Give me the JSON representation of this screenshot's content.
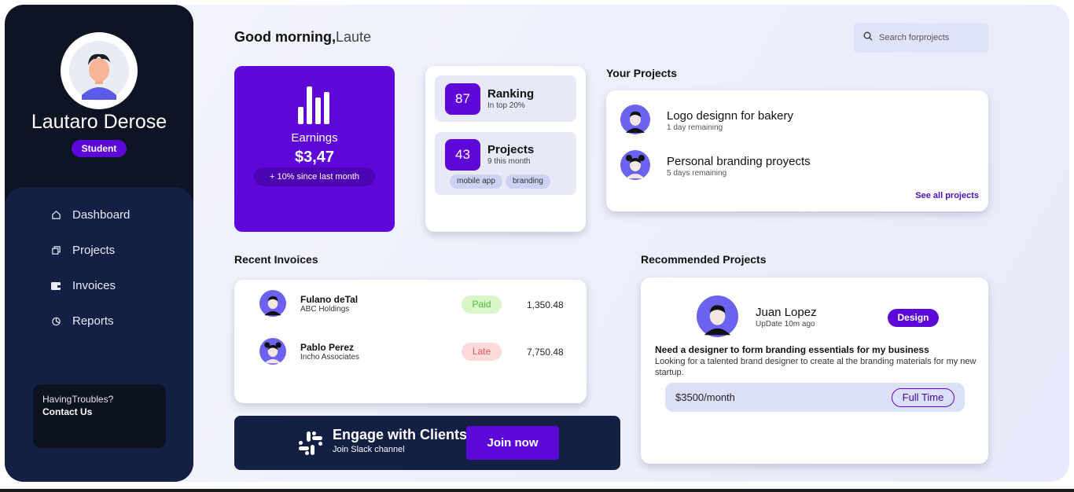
{
  "header": {
    "greeting": "Good morning,",
    "greeting_name": "Laute",
    "search_placeholder": "Search forprojects"
  },
  "sidebar": {
    "user_name": "Lautaro Derose",
    "role": "Student",
    "items": [
      {
        "label": "Dashboard",
        "icon": "home-icon"
      },
      {
        "label": "Projects",
        "icon": "copy-icon"
      },
      {
        "label": "Invoices",
        "icon": "wallet-icon"
      },
      {
        "label": "Reports",
        "icon": "pie-chart-icon"
      }
    ],
    "help": {
      "line1": "HavingTroubles?",
      "line2": "Contact Us"
    }
  },
  "earnings": {
    "title": "Earnings",
    "value": "$3,47",
    "change": "+ 10% since last month"
  },
  "stats": {
    "ranking": {
      "number": "87",
      "title": "Ranking",
      "subtitle": "In top 20%"
    },
    "projects": {
      "number": "43",
      "title": "Projects",
      "subtitle": "9 this month",
      "tags": [
        "mobile app",
        "branding"
      ]
    }
  },
  "your_projects": {
    "title": "Your Projects",
    "items": [
      {
        "title": "Logo designn for bakery",
        "subtitle": "1 day remaining"
      },
      {
        "title": "Personal branding proyects",
        "subtitle": "5 days remaining"
      }
    ],
    "see_all": "See all projects"
  },
  "invoices": {
    "title": "Recent Invoices",
    "rows": [
      {
        "name": "Fulano deTal",
        "company": "ABC Holdings",
        "status": "Paid",
        "amount": "1,350.48"
      },
      {
        "name": "Pablo Perez",
        "company": "Incho Associates",
        "status": "Late",
        "amount": "7,750.48"
      }
    ]
  },
  "slack": {
    "title": "Engage with Clients",
    "subtitle": "Join Slack channel",
    "button": "Join now"
  },
  "recommended": {
    "title": "Recommended Projects",
    "name": "Juan Lopez",
    "updated": "UpDate 10m ago",
    "badge": "Design",
    "headline": "Need a designer to form branding essentials for my business",
    "description": "Looking for a talented brand designer to create al the branding materials for my new startup.",
    "price": "$3500/month",
    "type": "Full Time"
  },
  "colors": {
    "accent": "#5f06d8",
    "sidebar": "#0e1424",
    "navy": "#141f44",
    "paid_bg": "#d9f6c9",
    "paid_text": "#4cbd35",
    "late_bg": "#fbdada",
    "late_text": "#e0595f"
  }
}
